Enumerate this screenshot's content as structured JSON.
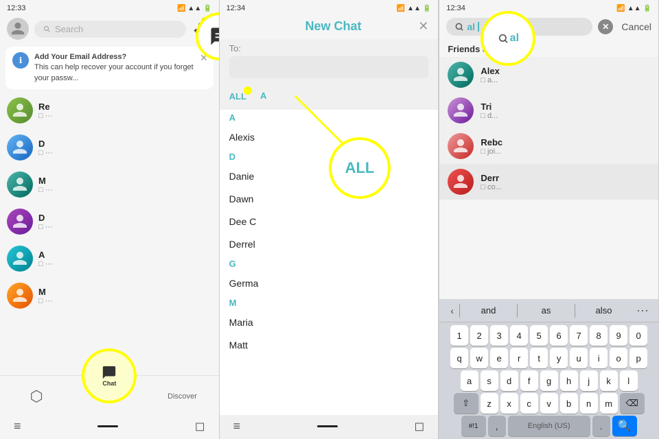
{
  "panel1": {
    "status_time": "12:33",
    "header": {
      "search_placeholder": "Search",
      "add_friends_icon": "person-plus-icon",
      "compose_icon": "compose-icon"
    },
    "notification": {
      "title": "Add Your Email Address?",
      "body": "This can help recover your account if you forget your passw...",
      "close_icon": "close-icon"
    },
    "chat_items": [
      {
        "name": "Re",
        "preview": "□ ..."
      },
      {
        "name": "D",
        "preview": "□ ..."
      },
      {
        "name": "M",
        "preview": "□ ..."
      },
      {
        "name": "D",
        "preview": "□ ..."
      },
      {
        "name": "A",
        "preview": "□ ..."
      },
      {
        "name": "M",
        "preview": "□ ..."
      }
    ],
    "bottom_nav": {
      "items": [
        {
          "label": "",
          "icon": "camera-icon"
        },
        {
          "label": "Chat",
          "icon": "chat-icon"
        },
        {
          "label": "Discover",
          "icon": "discover-icon"
        }
      ]
    },
    "highlight_compose_label": "compose icon highlighted",
    "highlight_chat_label": "chat tab highlighted"
  },
  "panel2": {
    "status_time": "12:34",
    "title": "New Chat",
    "close_icon": "close-icon",
    "to_label": "To:",
    "filter_tabs": [
      {
        "label": "ALL",
        "active": true
      },
      {
        "label": "A"
      }
    ],
    "contacts": [
      {
        "section": "A",
        "name": "Alexis"
      },
      {
        "section": "D",
        "name": "Danie"
      },
      {
        "section": null,
        "name": "Dawn"
      },
      {
        "section": null,
        "name": "Dee C"
      },
      {
        "section": null,
        "name": "Derrel"
      },
      {
        "section": "G",
        "name": "Germa"
      },
      {
        "section": "M",
        "name": "Maria"
      },
      {
        "section": null,
        "name": "Matt"
      }
    ],
    "highlight_all_label": "ALL filter highlighted"
  },
  "panel3": {
    "status_time": "12:34",
    "search_value": "al",
    "search_cursor": true,
    "cancel_label": "Cancel",
    "friends_section_title": "Friends & Groups",
    "friends": [
      {
        "name": "Alex",
        "sub": "a..."
      },
      {
        "name": "Tri",
        "sub": "d..."
      },
      {
        "name": "Rebc",
        "sub": "joi..."
      },
      {
        "name": "Derr",
        "sub": "co..."
      }
    ],
    "keyboard": {
      "suggestions": [
        "<",
        "and",
        "as",
        "also",
        "..."
      ],
      "rows": [
        [
          "1",
          "2",
          "3",
          "4",
          "5",
          "6",
          "7",
          "8",
          "9",
          "0"
        ],
        [
          "q",
          "w",
          "e",
          "r",
          "t",
          "y",
          "u",
          "i",
          "o",
          "p"
        ],
        [
          "a",
          "s",
          "d",
          "f",
          "g",
          "h",
          "j",
          "k",
          "l"
        ],
        [
          "⇧",
          "z",
          "x",
          "c",
          "v",
          "b",
          "n",
          "m",
          "⌫"
        ],
        [
          "#!1",
          ",",
          "English (US)",
          ".",
          "🔍"
        ]
      ]
    },
    "highlight_search_label": "search with typed al highlighted"
  }
}
